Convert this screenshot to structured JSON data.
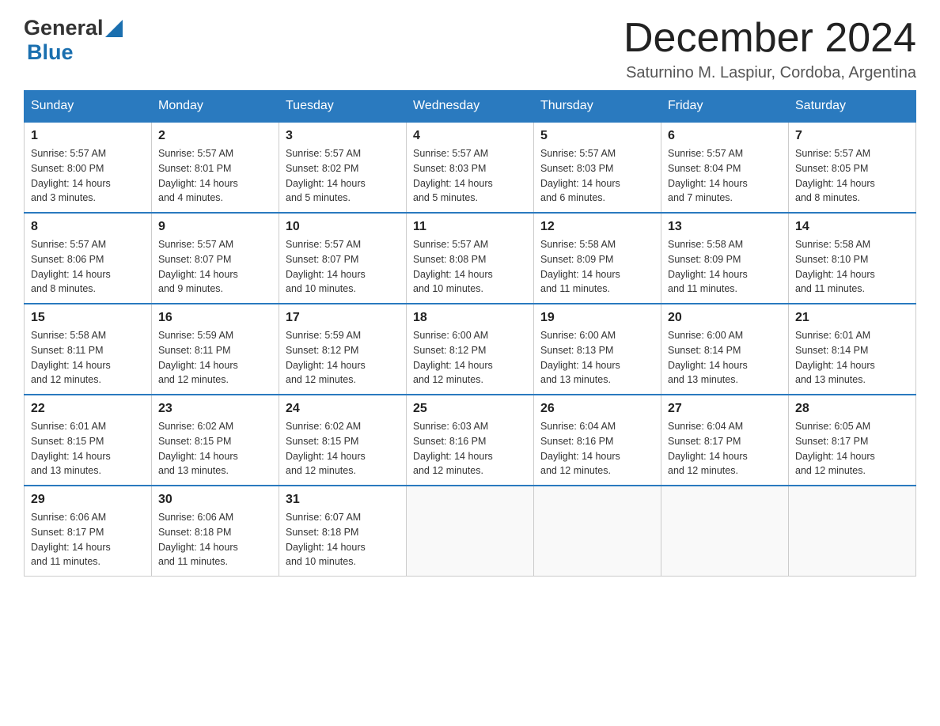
{
  "header": {
    "logo_general": "General",
    "logo_blue": "Blue",
    "month_title": "December 2024",
    "location": "Saturnino M. Laspiur, Cordoba, Argentina"
  },
  "days_of_week": [
    "Sunday",
    "Monday",
    "Tuesday",
    "Wednesday",
    "Thursday",
    "Friday",
    "Saturday"
  ],
  "weeks": [
    [
      {
        "day": "1",
        "sunrise": "5:57 AM",
        "sunset": "8:00 PM",
        "daylight": "14 hours and 3 minutes."
      },
      {
        "day": "2",
        "sunrise": "5:57 AM",
        "sunset": "8:01 PM",
        "daylight": "14 hours and 4 minutes."
      },
      {
        "day": "3",
        "sunrise": "5:57 AM",
        "sunset": "8:02 PM",
        "daylight": "14 hours and 5 minutes."
      },
      {
        "day": "4",
        "sunrise": "5:57 AM",
        "sunset": "8:03 PM",
        "daylight": "14 hours and 5 minutes."
      },
      {
        "day": "5",
        "sunrise": "5:57 AM",
        "sunset": "8:03 PM",
        "daylight": "14 hours and 6 minutes."
      },
      {
        "day": "6",
        "sunrise": "5:57 AM",
        "sunset": "8:04 PM",
        "daylight": "14 hours and 7 minutes."
      },
      {
        "day": "7",
        "sunrise": "5:57 AM",
        "sunset": "8:05 PM",
        "daylight": "14 hours and 8 minutes."
      }
    ],
    [
      {
        "day": "8",
        "sunrise": "5:57 AM",
        "sunset": "8:06 PM",
        "daylight": "14 hours and 8 minutes."
      },
      {
        "day": "9",
        "sunrise": "5:57 AM",
        "sunset": "8:07 PM",
        "daylight": "14 hours and 9 minutes."
      },
      {
        "day": "10",
        "sunrise": "5:57 AM",
        "sunset": "8:07 PM",
        "daylight": "14 hours and 10 minutes."
      },
      {
        "day": "11",
        "sunrise": "5:57 AM",
        "sunset": "8:08 PM",
        "daylight": "14 hours and 10 minutes."
      },
      {
        "day": "12",
        "sunrise": "5:58 AM",
        "sunset": "8:09 PM",
        "daylight": "14 hours and 11 minutes."
      },
      {
        "day": "13",
        "sunrise": "5:58 AM",
        "sunset": "8:09 PM",
        "daylight": "14 hours and 11 minutes."
      },
      {
        "day": "14",
        "sunrise": "5:58 AM",
        "sunset": "8:10 PM",
        "daylight": "14 hours and 11 minutes."
      }
    ],
    [
      {
        "day": "15",
        "sunrise": "5:58 AM",
        "sunset": "8:11 PM",
        "daylight": "14 hours and 12 minutes."
      },
      {
        "day": "16",
        "sunrise": "5:59 AM",
        "sunset": "8:11 PM",
        "daylight": "14 hours and 12 minutes."
      },
      {
        "day": "17",
        "sunrise": "5:59 AM",
        "sunset": "8:12 PM",
        "daylight": "14 hours and 12 minutes."
      },
      {
        "day": "18",
        "sunrise": "6:00 AM",
        "sunset": "8:12 PM",
        "daylight": "14 hours and 12 minutes."
      },
      {
        "day": "19",
        "sunrise": "6:00 AM",
        "sunset": "8:13 PM",
        "daylight": "14 hours and 13 minutes."
      },
      {
        "day": "20",
        "sunrise": "6:00 AM",
        "sunset": "8:14 PM",
        "daylight": "14 hours and 13 minutes."
      },
      {
        "day": "21",
        "sunrise": "6:01 AM",
        "sunset": "8:14 PM",
        "daylight": "14 hours and 13 minutes."
      }
    ],
    [
      {
        "day": "22",
        "sunrise": "6:01 AM",
        "sunset": "8:15 PM",
        "daylight": "14 hours and 13 minutes."
      },
      {
        "day": "23",
        "sunrise": "6:02 AM",
        "sunset": "8:15 PM",
        "daylight": "14 hours and 13 minutes."
      },
      {
        "day": "24",
        "sunrise": "6:02 AM",
        "sunset": "8:15 PM",
        "daylight": "14 hours and 12 minutes."
      },
      {
        "day": "25",
        "sunrise": "6:03 AM",
        "sunset": "8:16 PM",
        "daylight": "14 hours and 12 minutes."
      },
      {
        "day": "26",
        "sunrise": "6:04 AM",
        "sunset": "8:16 PM",
        "daylight": "14 hours and 12 minutes."
      },
      {
        "day": "27",
        "sunrise": "6:04 AM",
        "sunset": "8:17 PM",
        "daylight": "14 hours and 12 minutes."
      },
      {
        "day": "28",
        "sunrise": "6:05 AM",
        "sunset": "8:17 PM",
        "daylight": "14 hours and 12 minutes."
      }
    ],
    [
      {
        "day": "29",
        "sunrise": "6:06 AM",
        "sunset": "8:17 PM",
        "daylight": "14 hours and 11 minutes."
      },
      {
        "day": "30",
        "sunrise": "6:06 AM",
        "sunset": "8:18 PM",
        "daylight": "14 hours and 11 minutes."
      },
      {
        "day": "31",
        "sunrise": "6:07 AM",
        "sunset": "8:18 PM",
        "daylight": "14 hours and 10 minutes."
      },
      null,
      null,
      null,
      null
    ]
  ],
  "labels": {
    "sunrise": "Sunrise:",
    "sunset": "Sunset:",
    "daylight": "Daylight:"
  }
}
